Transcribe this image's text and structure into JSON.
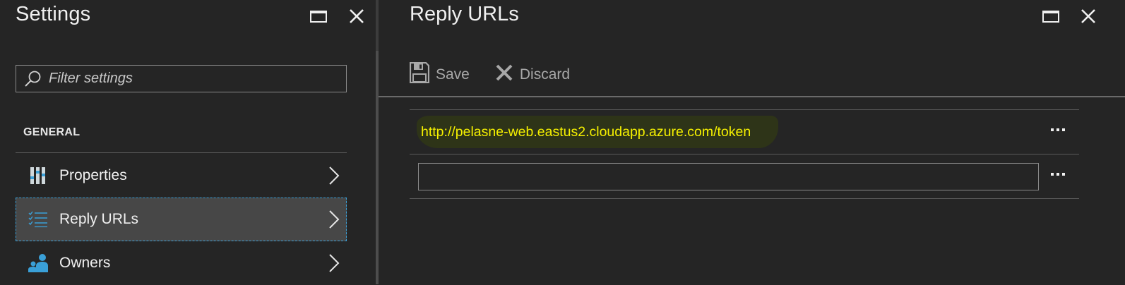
{
  "settings_blade": {
    "title": "Settings",
    "filter": {
      "placeholder": "Filter settings",
      "value": ""
    },
    "section_header": "GENERAL",
    "items": [
      {
        "label": "Properties",
        "icon": "properties-icon",
        "selected": false
      },
      {
        "label": "Reply URLs",
        "icon": "reply-urls-icon",
        "selected": true
      },
      {
        "label": "Owners",
        "icon": "owners-icon",
        "selected": false
      }
    ]
  },
  "reply_urls_blade": {
    "title": "Reply URLs",
    "toolbar": {
      "save_label": "Save",
      "discard_label": "Discard"
    },
    "urls": [
      {
        "value": "http://pelasne-web.eastus2.cloudapp.azure.com/token",
        "highlighted": true
      }
    ],
    "new_url": {
      "value": "",
      "placeholder": ""
    },
    "more_label": "..."
  },
  "colors": {
    "background": "#252525",
    "selected_item": "#474747",
    "selection_outline": "#3aa0d8",
    "url_text": "#f5f000",
    "icon_blue": "#3aa0d8"
  }
}
